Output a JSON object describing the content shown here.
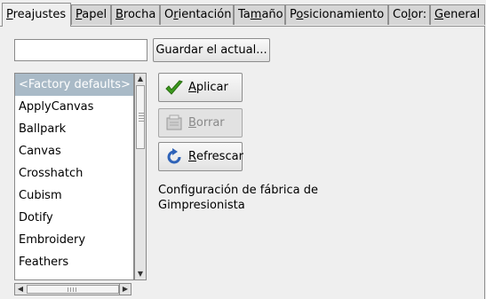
{
  "tabs": [
    {
      "prefix": "",
      "accel": "P",
      "rest": "reajustes"
    },
    {
      "prefix": "",
      "accel": "P",
      "rest": "apel"
    },
    {
      "prefix": "",
      "accel": "B",
      "rest": "rocha"
    },
    {
      "prefix": "O",
      "accel": "r",
      "rest": "ientación"
    },
    {
      "prefix": "Ta",
      "accel": "m",
      "rest": "año"
    },
    {
      "prefix": "P",
      "accel": "o",
      "rest": "sicionamiento"
    },
    {
      "prefix": "Co",
      "accel": "l",
      "rest": "or:"
    },
    {
      "prefix": "",
      "accel": "G",
      "rest": "eneral"
    }
  ],
  "preset_name": {
    "value": ""
  },
  "save_button": {
    "label": "Guardar el actual..."
  },
  "presets": [
    "<Factory defaults>",
    "ApplyCanvas",
    "Ballpark",
    "Canvas",
    "Crosshatch",
    "Cubism",
    "Dotify",
    "Embroidery",
    "Feathers"
  ],
  "buttons": {
    "apply": {
      "accel": "A",
      "rest": "plicar"
    },
    "delete": {
      "accel": "B",
      "rest": "orrar"
    },
    "refresh": {
      "accel": "R",
      "rest": "efrescar"
    }
  },
  "description": "Configuración de fábrica de Gimpresionista",
  "icons": {
    "apply": "checkmark-icon",
    "delete": "delete-icon",
    "refresh": "refresh-icon"
  },
  "colors": {
    "selected_row": "#a9bac7",
    "apply_check": "#3c9a1e",
    "refresh_arrow": "#2f63b8"
  }
}
